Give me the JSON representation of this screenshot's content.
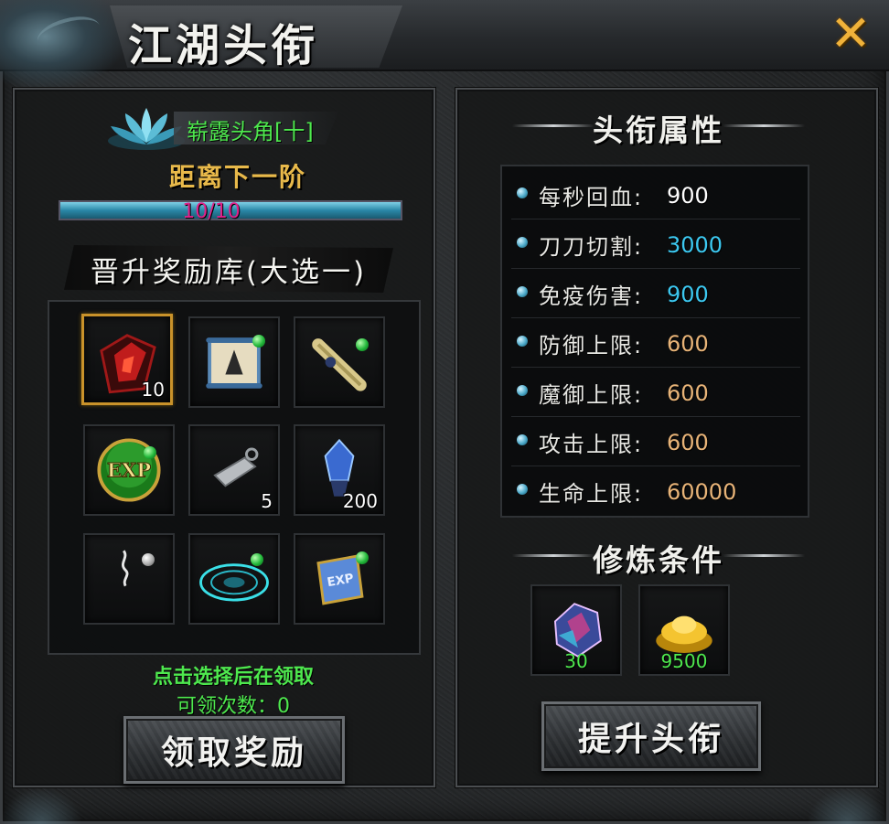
{
  "window": {
    "title": "江湖头衔",
    "close_icon": "close-x-icon"
  },
  "rank": {
    "name": "崭露头角[十]",
    "next_label": "距离下一阶",
    "progress_text": "10/10",
    "progress": 1.0
  },
  "rewards": {
    "title": "晋升奖励库(大选一)",
    "items": [
      {
        "icon": "red-armor-icon",
        "count": "10",
        "selected": true,
        "dot": false
      },
      {
        "icon": "scroll-painting-icon",
        "count": "",
        "selected": false,
        "dot": true
      },
      {
        "icon": "bamboo-scroll-icon",
        "count": "",
        "selected": false,
        "dot": true
      },
      {
        "icon": "exp-orb-icon",
        "count": "",
        "selected": false,
        "dot": true
      },
      {
        "icon": "silver-token-icon",
        "count": "5",
        "selected": false,
        "dot": false
      },
      {
        "icon": "blue-crystal-icon",
        "count": "200",
        "selected": false,
        "dot": false
      },
      {
        "icon": "white-smoke-icon",
        "count": "",
        "selected": false,
        "dot": true
      },
      {
        "icon": "magic-circle-icon",
        "count": "",
        "selected": false,
        "dot": true
      },
      {
        "icon": "exp-scroll-icon",
        "count": "",
        "selected": false,
        "dot": true
      }
    ],
    "hint": "点击选择后在领取",
    "claims_text": "可领次数：0",
    "claim_button": "领取奖励"
  },
  "attributes": {
    "title": "头衔属性",
    "rows": [
      {
        "label": "每秒回血:",
        "value": "900",
        "color": "#ffffff"
      },
      {
        "label": "刀刀切割:",
        "value": "3000",
        "color": "#3cc8f0"
      },
      {
        "label": "免疫伤害:",
        "value": "900",
        "color": "#3cc8f0"
      },
      {
        "label": "防御上限:",
        "value": "600",
        "color": "#e8b478"
      },
      {
        "label": "魔御上限:",
        "value": "600",
        "color": "#e8b478"
      },
      {
        "label": "攻击上限:",
        "value": "600",
        "color": "#e8b478"
      },
      {
        "label": "生命上限:",
        "value": "60000",
        "color": "#e8b478"
      }
    ]
  },
  "requirements": {
    "title": "修炼条件",
    "items": [
      {
        "icon": "spirit-stone-icon",
        "count": "30"
      },
      {
        "icon": "gold-ingot-icon",
        "count": "9500"
      }
    ],
    "upgrade_button": "提升头衔"
  }
}
